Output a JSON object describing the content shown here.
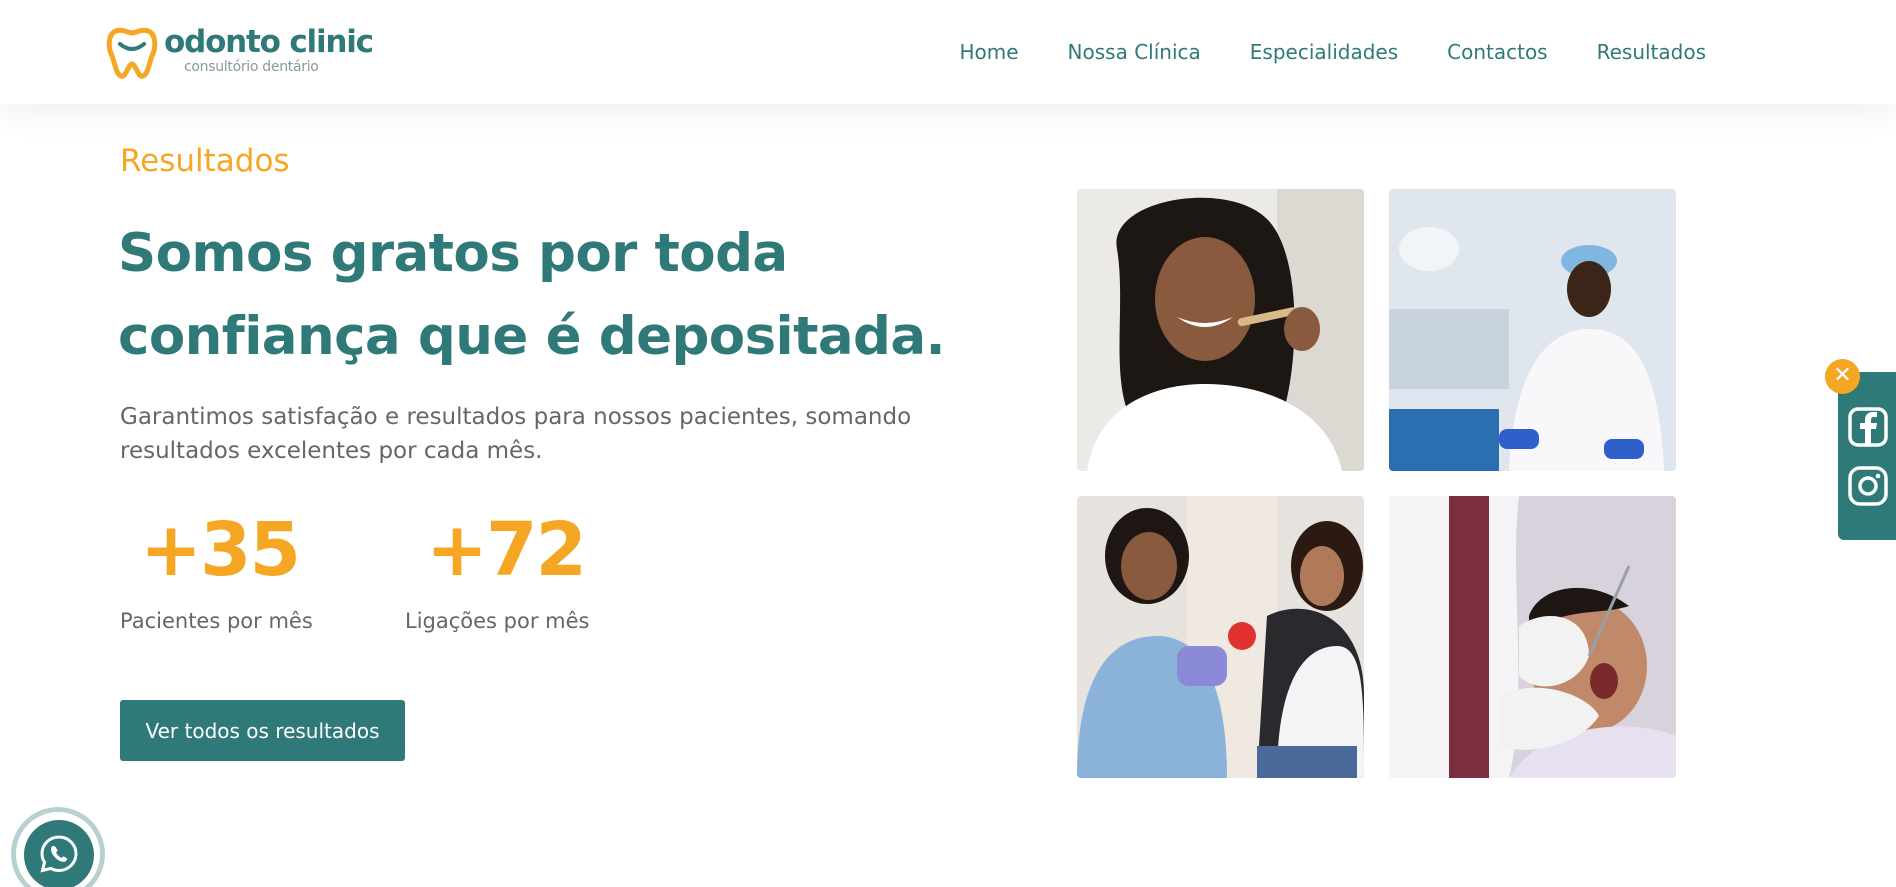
{
  "brand": {
    "name": "odonto clinic",
    "tagline": "consultório dentário",
    "accent_color": "#f5a623",
    "primary_color": "#2f7a78"
  },
  "nav": {
    "items": [
      "Home",
      "Nossa Clínica",
      "Especialidades",
      "Contactos",
      "Resultados"
    ]
  },
  "main": {
    "section_label": "Resultados",
    "headline_line1": "Somos gratos por toda",
    "headline_line2": "confiança que é depositada.",
    "description": "Garantimos satisfação e resultados para nossos pacientes, somando resultados excelentes por cada mês.",
    "stats": [
      {
        "value": "+35",
        "label": "Pacientes por mês"
      },
      {
        "value": "+72",
        "label": "Ligações por mês"
      }
    ],
    "cta_label": "Ver todos os resultados"
  },
  "gallery": {
    "icons": [
      "woman-toothbrush-photo",
      "dentist-smiling-photo",
      "dentist-child-photo",
      "dental-exam-photo"
    ]
  },
  "social": {
    "close_glyph": "✕",
    "icons": [
      "facebook-icon",
      "instagram-icon"
    ]
  },
  "whatsapp": {
    "icon": "whatsapp-icon"
  }
}
